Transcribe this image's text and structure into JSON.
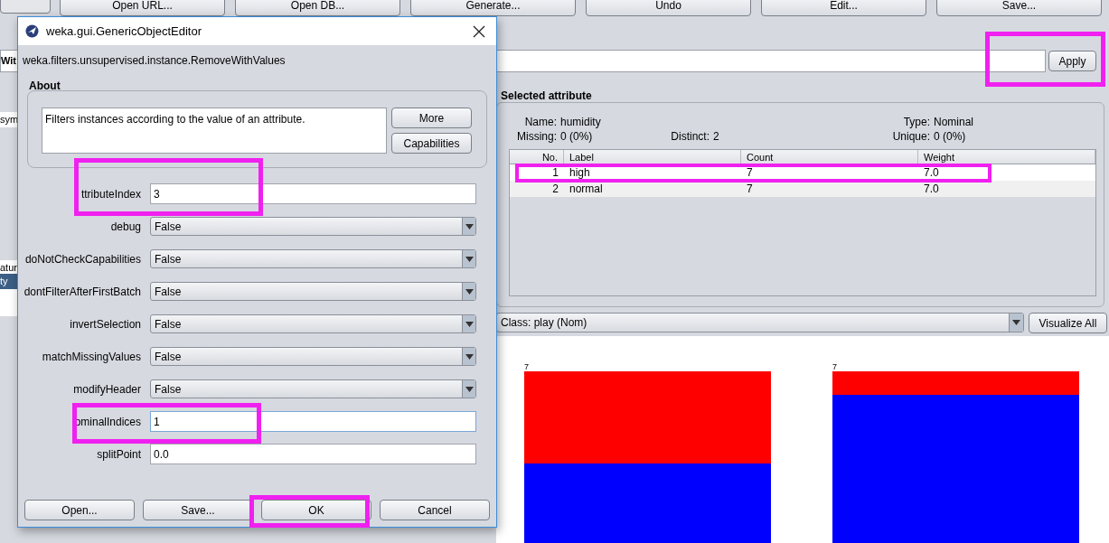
{
  "toolbar": {
    "buttons": [
      "Open URL...",
      "Open DB...",
      "Generate...",
      "Undo",
      "Edit...",
      "Save..."
    ]
  },
  "filter": {
    "name_fragment": "Wit",
    "apply": "Apply"
  },
  "attribute_list": {
    "items": [
      {
        "label": "sym",
        "selected": false
      },
      {
        "label": "atur",
        "selected": false
      },
      {
        "label": "ty",
        "selected": true
      }
    ]
  },
  "selected_attribute": {
    "title": "Selected attribute",
    "name_label": "Name:",
    "name": "humidity",
    "type_label": "Type:",
    "type": "Nominal",
    "missing_label": "Missing:",
    "missing": "0 (0%)",
    "distinct_label": "Distinct:",
    "distinct": "2",
    "unique_label": "Unique:",
    "unique": "0 (0%)",
    "columns": [
      "No.",
      "Label",
      "Count",
      "Weight"
    ],
    "rows": [
      {
        "no": "1",
        "label": "high",
        "count": "7",
        "weight": "7.0",
        "selected": true
      },
      {
        "no": "2",
        "label": "normal",
        "count": "7",
        "weight": "7.0",
        "selected": false
      }
    ]
  },
  "class_select": {
    "value": "Class: play (Nom)",
    "button": "Visualize All"
  },
  "histogram": {
    "bars": [
      {
        "label": "7"
      },
      {
        "label": "7"
      }
    ]
  },
  "dialog": {
    "title": "weka.gui.GenericObjectEditor",
    "class_name": "weka.filters.unsupervised.instance.RemoveWithValues",
    "about_title": "About",
    "about_text": "Filters instances according to the value of an attribute.",
    "about_buttons": [
      "More",
      "Capabilities"
    ],
    "properties": [
      {
        "label": "ttributeIndex",
        "kind": "text",
        "value": "3"
      },
      {
        "label": "debug",
        "kind": "select",
        "value": "False"
      },
      {
        "label": "doNotCheckCapabilities",
        "kind": "select",
        "value": "False"
      },
      {
        "label": "dontFilterAfterFirstBatch",
        "kind": "select",
        "value": "False"
      },
      {
        "label": "invertSelection",
        "kind": "select",
        "value": "False"
      },
      {
        "label": "matchMissingValues",
        "kind": "select",
        "value": "False"
      },
      {
        "label": "modifyHeader",
        "kind": "select",
        "value": "False"
      },
      {
        "label": "ominalIndices",
        "kind": "text",
        "value": "1",
        "focused": true
      },
      {
        "label": "splitPoint",
        "kind": "text",
        "value": "0.0"
      }
    ],
    "buttons": [
      "Open...",
      "Save...",
      "OK",
      "Cancel"
    ]
  }
}
